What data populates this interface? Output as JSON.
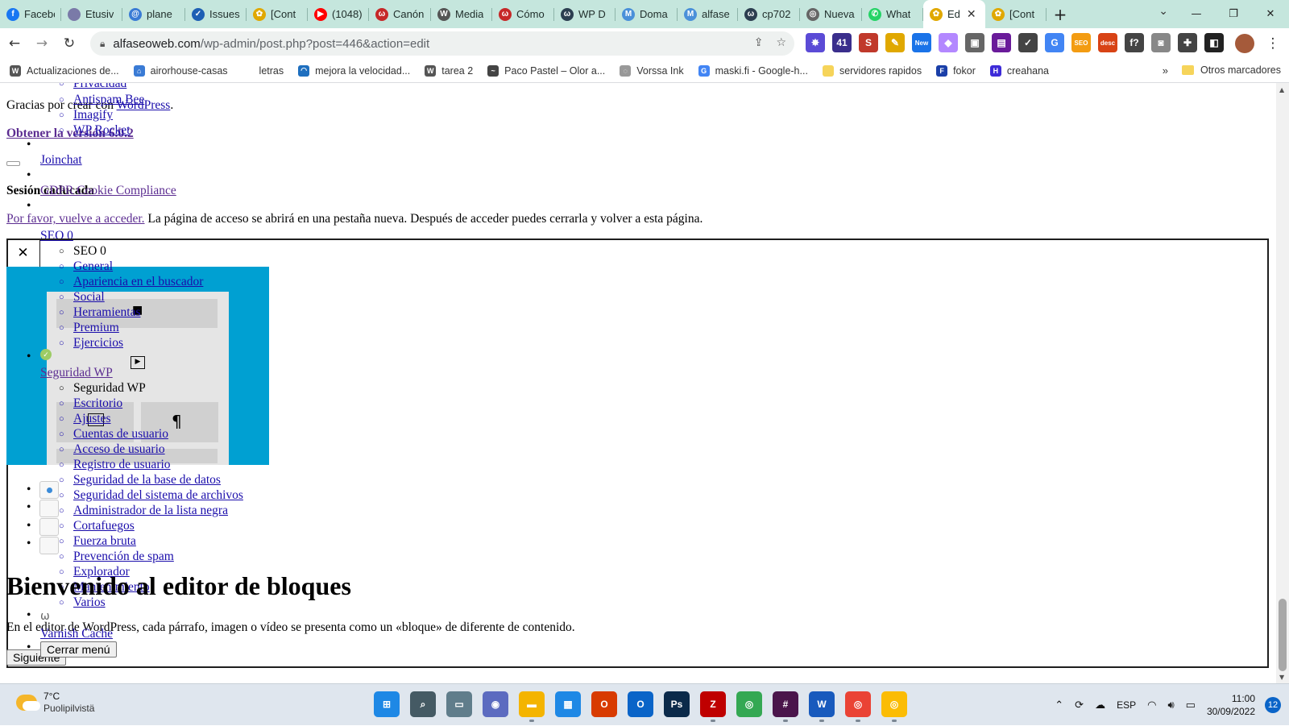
{
  "browser": {
    "tabs": [
      {
        "title": "Facebo",
        "icon": "facebook-icon",
        "color": "#1877f2",
        "glyph": "f"
      },
      {
        "title": "Etusiv",
        "icon": "page-icon",
        "color": "#7a7aa8",
        "glyph": ""
      },
      {
        "title": "plane",
        "icon": "planet-icon",
        "color": "#3a7bd5",
        "glyph": "@"
      },
      {
        "title": "Issues",
        "icon": "checkbox-icon",
        "color": "#1e5fb4",
        "glyph": "✓"
      },
      {
        "title": "[Cont",
        "icon": "flower-icon",
        "color": "#e0a800",
        "glyph": "✿"
      },
      {
        "title": "(1048)",
        "icon": "youtube-icon",
        "color": "#ff0000",
        "glyph": "▶"
      },
      {
        "title": "Canón",
        "icon": "w-icon",
        "color": "#c62828",
        "glyph": "ω"
      },
      {
        "title": "Media",
        "icon": "wordpress-icon",
        "color": "#555555",
        "glyph": "W"
      },
      {
        "title": "Cómo",
        "icon": "w-icon",
        "color": "#c62828",
        "glyph": "ω"
      },
      {
        "title": "WP D",
        "icon": "w-icon",
        "color": "#2c3e50",
        "glyph": "ω"
      },
      {
        "title": "Doma",
        "icon": "gmail-icon",
        "color": "#4a90d9",
        "glyph": "M"
      },
      {
        "title": "alfase",
        "icon": "gmail-icon",
        "color": "#4a90d9",
        "glyph": "M"
      },
      {
        "title": "cp702",
        "icon": "w-icon",
        "color": "#2c3e50",
        "glyph": "ω"
      },
      {
        "title": "Nueva",
        "icon": "chrome-icon",
        "color": "#666666",
        "glyph": "◎"
      },
      {
        "title": "What",
        "icon": "whatsapp-icon",
        "color": "#25d366",
        "glyph": "✆"
      },
      {
        "title": "Ed",
        "icon": "flower-icon",
        "color": "#e0a800",
        "glyph": "✿",
        "active": true
      },
      {
        "title": "[Cont",
        "icon": "flower-icon",
        "color": "#e0a800",
        "glyph": "✿"
      }
    ],
    "url_host": "alfaseoweb.com",
    "url_path": "/wp-admin/post.php?post=446&action=edit",
    "extensions": [
      {
        "name": "gear-ext-icon",
        "color": "#5b4bd6",
        "glyph": "✸"
      },
      {
        "name": "hat-ext-icon",
        "color": "#3a2e8c",
        "glyph": "41"
      },
      {
        "name": "s-ext-icon",
        "color": "#c0392b",
        "glyph": "S"
      },
      {
        "name": "pen-ext-icon",
        "color": "#e0a800",
        "glyph": "✎"
      },
      {
        "name": "new-ext-icon",
        "color": "#1a73e8",
        "glyph": "New"
      },
      {
        "name": "tag-ext-icon",
        "color": "#b388ff",
        "glyph": "◆"
      },
      {
        "name": "image-ext-icon",
        "color": "#666666",
        "glyph": "▣"
      },
      {
        "name": "picture-ext-icon",
        "color": "#6a1b9a",
        "glyph": "▤"
      },
      {
        "name": "compass-ext-icon",
        "color": "#444444",
        "glyph": "✓"
      },
      {
        "name": "translate-ext-icon",
        "color": "#4285f4",
        "glyph": "G"
      },
      {
        "name": "seo-ext-icon",
        "color": "#f39c12",
        "glyph": "SEO"
      },
      {
        "name": "desc-ext-icon",
        "color": "#d84315",
        "glyph": "desc"
      },
      {
        "name": "formula-ext-icon",
        "color": "#444444",
        "glyph": "f?"
      },
      {
        "name": "camera-ext-icon",
        "color": "#888888",
        "glyph": "◙"
      },
      {
        "name": "puzzle-ext-icon",
        "color": "#444444",
        "glyph": "✚"
      },
      {
        "name": "sidepanel-ext-icon",
        "color": "#222222",
        "glyph": "◧"
      }
    ],
    "bookmarks": [
      {
        "label": "Actualizaciones de...",
        "icon": "wordpress-icon",
        "color": "#555555",
        "glyph": "W"
      },
      {
        "label": "airorhouse-casas",
        "icon": "house-icon",
        "color": "#3a7bd5",
        "glyph": "⌂"
      },
      {
        "label": "letras",
        "icon": "",
        "color": "",
        "glyph": ""
      },
      {
        "label": "mejora la velocidad...",
        "icon": "speed-icon",
        "color": "#1e6fbf",
        "glyph": "◠"
      },
      {
        "label": "tarea 2",
        "icon": "wordpress-icon",
        "color": "#555555",
        "glyph": "W"
      },
      {
        "label": "Paco Pastel – Olor a...",
        "icon": "mustache-icon",
        "color": "#444444",
        "glyph": "~"
      },
      {
        "label": "Vorssa Ink",
        "icon": "globe-icon",
        "color": "#999999",
        "glyph": "◌"
      },
      {
        "label": "maski.fi - Google-h...",
        "icon": "google-icon",
        "color": "#4285f4",
        "glyph": "G"
      },
      {
        "label": "servidores rapidos",
        "icon": "folder-icon",
        "color": "#f6d45a",
        "glyph": ""
      },
      {
        "label": "fokor",
        "icon": "f-icon",
        "color": "#1a3fa8",
        "glyph": "F"
      },
      {
        "label": "creahana",
        "icon": "h-icon",
        "color": "#3d2bd8",
        "glyph": "H"
      }
    ],
    "bookmarks_more": "»",
    "other_bookmarks": "Otros marcadores"
  },
  "page": {
    "privacidad": "Privacidad",
    "gracias_prefix": "Gracias por crear con ",
    "wordpress_link": "WordPress",
    "gracias_suffix": ".",
    "antispam": "Antispam Bee",
    "imagify": "Imagify",
    "obtener": "Obtener la versión 6.0.2",
    "wp_rocket": "WP Rocket",
    "joinchat": "Joinchat",
    "sesion": "Sesión caducada",
    "gdpr": "GDPR Cookie Compliance",
    "login_prefix": "Por favor, vuelve a acceder.",
    "login_text": " La página de acceso se abrirá en una pestaña nueva. Después de acceder puedes cerrarla y volver a esta página.",
    "seo_link": "SEO 0",
    "seo_title": "SEO 0",
    "seo_items": [
      "General",
      "Apariencia en el buscador",
      "Social",
      "Herramientas",
      "Premium",
      "Ejercicios"
    ],
    "seguridad_link": "Seguridad WP",
    "seguridad_title": "Seguridad WP",
    "seguridad_items": [
      "Escritorio",
      "Ajustes",
      "Cuentas de usuario",
      "Acceso de usuario",
      "Registro de usuario",
      "Seguridad de la base de datos",
      "Seguridad del sistema de archivos",
      "Administrador de la lista negra",
      "Cortafuegos",
      "Fuerza bruta",
      "Prevención de spam",
      "Explorador",
      "Mantenimiento",
      "Varios"
    ],
    "varnish": "Varnish Cache",
    "welcome_title": "Bienvenido al editor de bloques",
    "welcome_text": "En el editor de WordPress, cada párrafo, imagen o vídeo se presenta como un «bloque» de diferente de contenido.",
    "next_button": "Siguiente",
    "close_menu_button": "Cerrar menú",
    "close_glyph": "✕",
    "paragraph_glyph": "¶"
  },
  "taskbar": {
    "temp": "7°C",
    "weather": "Puolipilvistä",
    "apps": [
      {
        "name": "start-icon",
        "color": "#1e88e5",
        "glyph": "⊞",
        "state": ""
      },
      {
        "name": "search-icon",
        "color": "#455a64",
        "glyph": "⌕",
        "state": ""
      },
      {
        "name": "taskview-icon",
        "color": "#607d8b",
        "glyph": "▭",
        "state": ""
      },
      {
        "name": "chat-icon",
        "color": "#5c6bc0",
        "glyph": "◉",
        "state": ""
      },
      {
        "name": "explorer-icon",
        "color": "#f4b400",
        "glyph": "▬",
        "state": "running"
      },
      {
        "name": "store-icon",
        "color": "#1e88e5",
        "glyph": "▦",
        "state": ""
      },
      {
        "name": "office-icon",
        "color": "#d83b01",
        "glyph": "O",
        "state": ""
      },
      {
        "name": "outlook-icon",
        "color": "#0a64c8",
        "glyph": "O",
        "state": ""
      },
      {
        "name": "photoshop-icon",
        "color": "#0b2a4a",
        "glyph": "Ps",
        "state": ""
      },
      {
        "name": "filezilla-icon",
        "color": "#bf0000",
        "glyph": "Z",
        "state": "running"
      },
      {
        "name": "chrome-icon",
        "color": "#34a853",
        "glyph": "◎",
        "state": "active"
      },
      {
        "name": "slack-icon",
        "color": "#4a154b",
        "glyph": "#",
        "state": "running"
      },
      {
        "name": "word-icon",
        "color": "#185abd",
        "glyph": "W",
        "state": "running"
      },
      {
        "name": "chrome-profile-icon",
        "color": "#ea4335",
        "glyph": "◎",
        "state": "running"
      },
      {
        "name": "chrome-profile-2-icon",
        "color": "#fbbc05",
        "glyph": "◎",
        "state": "running"
      }
    ],
    "lang": "ESP",
    "time": "11:00",
    "date": "30/09/2022",
    "notifications": "12"
  }
}
